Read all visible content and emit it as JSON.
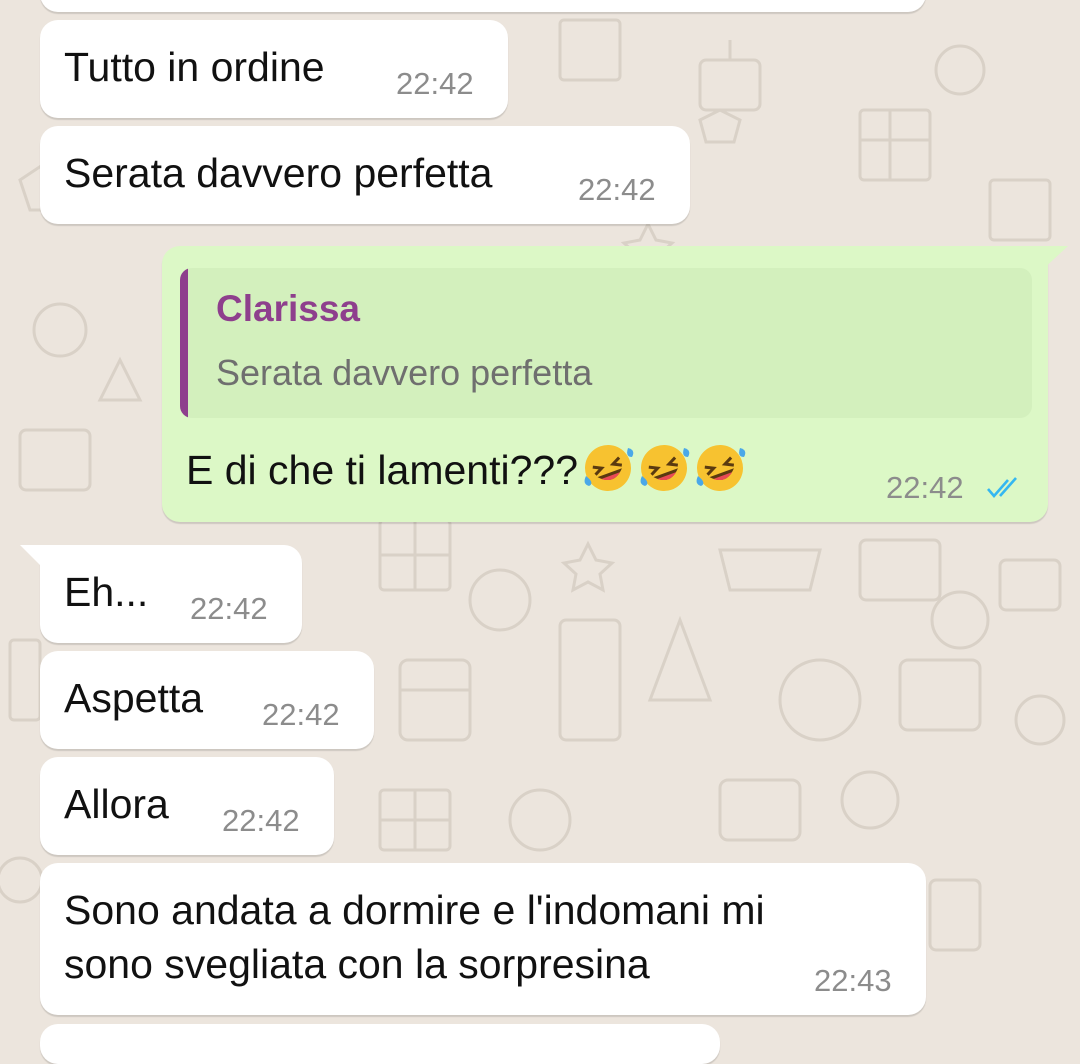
{
  "colors": {
    "background": "#ece5dd",
    "incoming_bubble": "#ffffff",
    "outgoing_bubble": "#dcf8c6",
    "quote_accent": "#8e3f8d",
    "read_ticks": "#34b7f1"
  },
  "messages": [
    {
      "text": "Tutto in ordine",
      "time": "22:42"
    },
    {
      "text": "Serata davvero perfetta",
      "time": "22:42"
    },
    {
      "quote_author": "Clarissa",
      "quote_text": "Serata davvero perfetta",
      "text": "E di che ti lamenti???",
      "emoji": [
        "rolling-on-floor-laughing-emoji",
        "rolling-on-floor-laughing-emoji",
        "rolling-on-floor-laughing-emoji"
      ],
      "time": "22:42",
      "status_icon": "double-check-read-icon"
    },
    {
      "text": "Eh...",
      "time": "22:42"
    },
    {
      "text": "Aspetta",
      "time": "22:42"
    },
    {
      "text": "Allora",
      "time": "22:42"
    },
    {
      "text_line1": "Sono andata a dormire e l'indomani mi",
      "text_line2": "sono svegliata con la sorpresina",
      "time": "22:43"
    }
  ]
}
